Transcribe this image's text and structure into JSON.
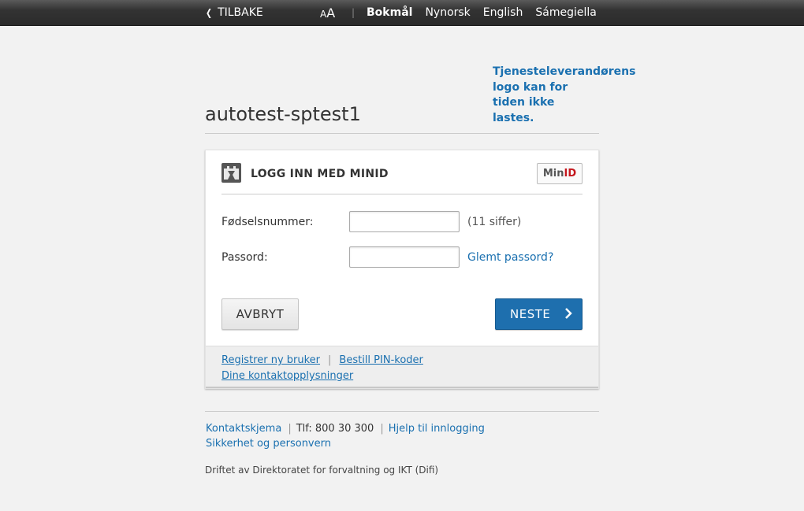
{
  "topbar": {
    "back_label": "TILBAKE",
    "font_size_small": "A",
    "font_size_large": "A",
    "separator": "|",
    "languages": [
      {
        "label": "Bokmål",
        "active": true
      },
      {
        "label": "Nynorsk",
        "active": false
      },
      {
        "label": "English",
        "active": false
      },
      {
        "label": "Sámegiella",
        "active": false
      }
    ]
  },
  "service": {
    "title": "autotest-sptest1",
    "logo_fallback_line1": "Tjenesteleverandørens",
    "logo_fallback_rest": "logo kan for tiden ikke lastes."
  },
  "login": {
    "heading": "LOGG INN MED MINID",
    "badge_min": "Min",
    "badge_id": "ID",
    "ssn_label": "Fødselsnummer:",
    "ssn_value": "",
    "ssn_hint": "(11 siffer)",
    "password_label": "Passord:",
    "password_value": "",
    "forgot_label": "Glemt passord?",
    "cancel_label": "AVBRYT",
    "next_label": "NESTE"
  },
  "card_footer": {
    "register": "Registrer ny bruker",
    "order_pin": "Bestill PIN-koder",
    "contact_info": "Dine kontaktopplysninger"
  },
  "footer": {
    "contact_form": "Kontaktskjema",
    "phone": "Tlf: 800 30 300",
    "help": "Hjelp til innlogging",
    "security": "Sikkerhet og personvern",
    "operated_by": "Driftet av Direktoratet for forvaltning og IKT (Difi)"
  },
  "colors": {
    "link": "#1a70b0",
    "primary_button": "#1e6fae",
    "topbar": "#333333",
    "minid_red": "#c4161c"
  }
}
